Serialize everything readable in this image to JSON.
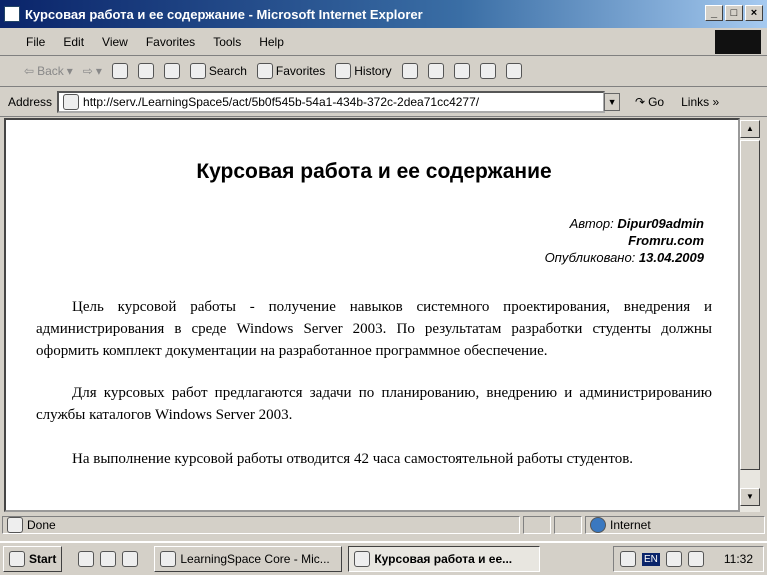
{
  "window": {
    "title": "Курсовая работа и ее содержание - Microsoft Internet Explorer"
  },
  "menu": [
    "File",
    "Edit",
    "View",
    "Favorites",
    "Tools",
    "Help"
  ],
  "toolbar": {
    "back": "Back",
    "search": "Search",
    "favorites": "Favorites",
    "history": "History"
  },
  "address": {
    "label": "Address",
    "url": "http://serv./LearningSpace5/act/5b0f545b-54a1-434b-372c-2dea71cc4277/",
    "go": "Go",
    "links": "Links »"
  },
  "page": {
    "title": "Курсовая работа и ее содержание",
    "author_label": "Автор:",
    "author": "Dipur09admin",
    "source": "Fromru.com",
    "published_label": "Опубликовано:",
    "published": "13.04.2009",
    "paragraphs": [
      "Цель курсовой работы - получение навыков системного проектирования, внедрения и администрирования в среде Windows Server 2003. По результатам разработки студенты должны оформить комплект документации на разработанное программное обеспечение.",
      "Для курсовых работ предлагаются задачи по планированию, внедрению и администрированию службы каталогов Windows Server 2003.",
      "На выполнение курсовой работы отводится 42 часа самостоятельной работы студентов."
    ]
  },
  "status": {
    "text": "Done",
    "zone": "Internet"
  },
  "taskbar": {
    "start": "Start",
    "tasks": [
      "LearningSpace Core - Mic...",
      "Курсовая работа и ее..."
    ],
    "lang": "EN",
    "clock": "11:32"
  }
}
